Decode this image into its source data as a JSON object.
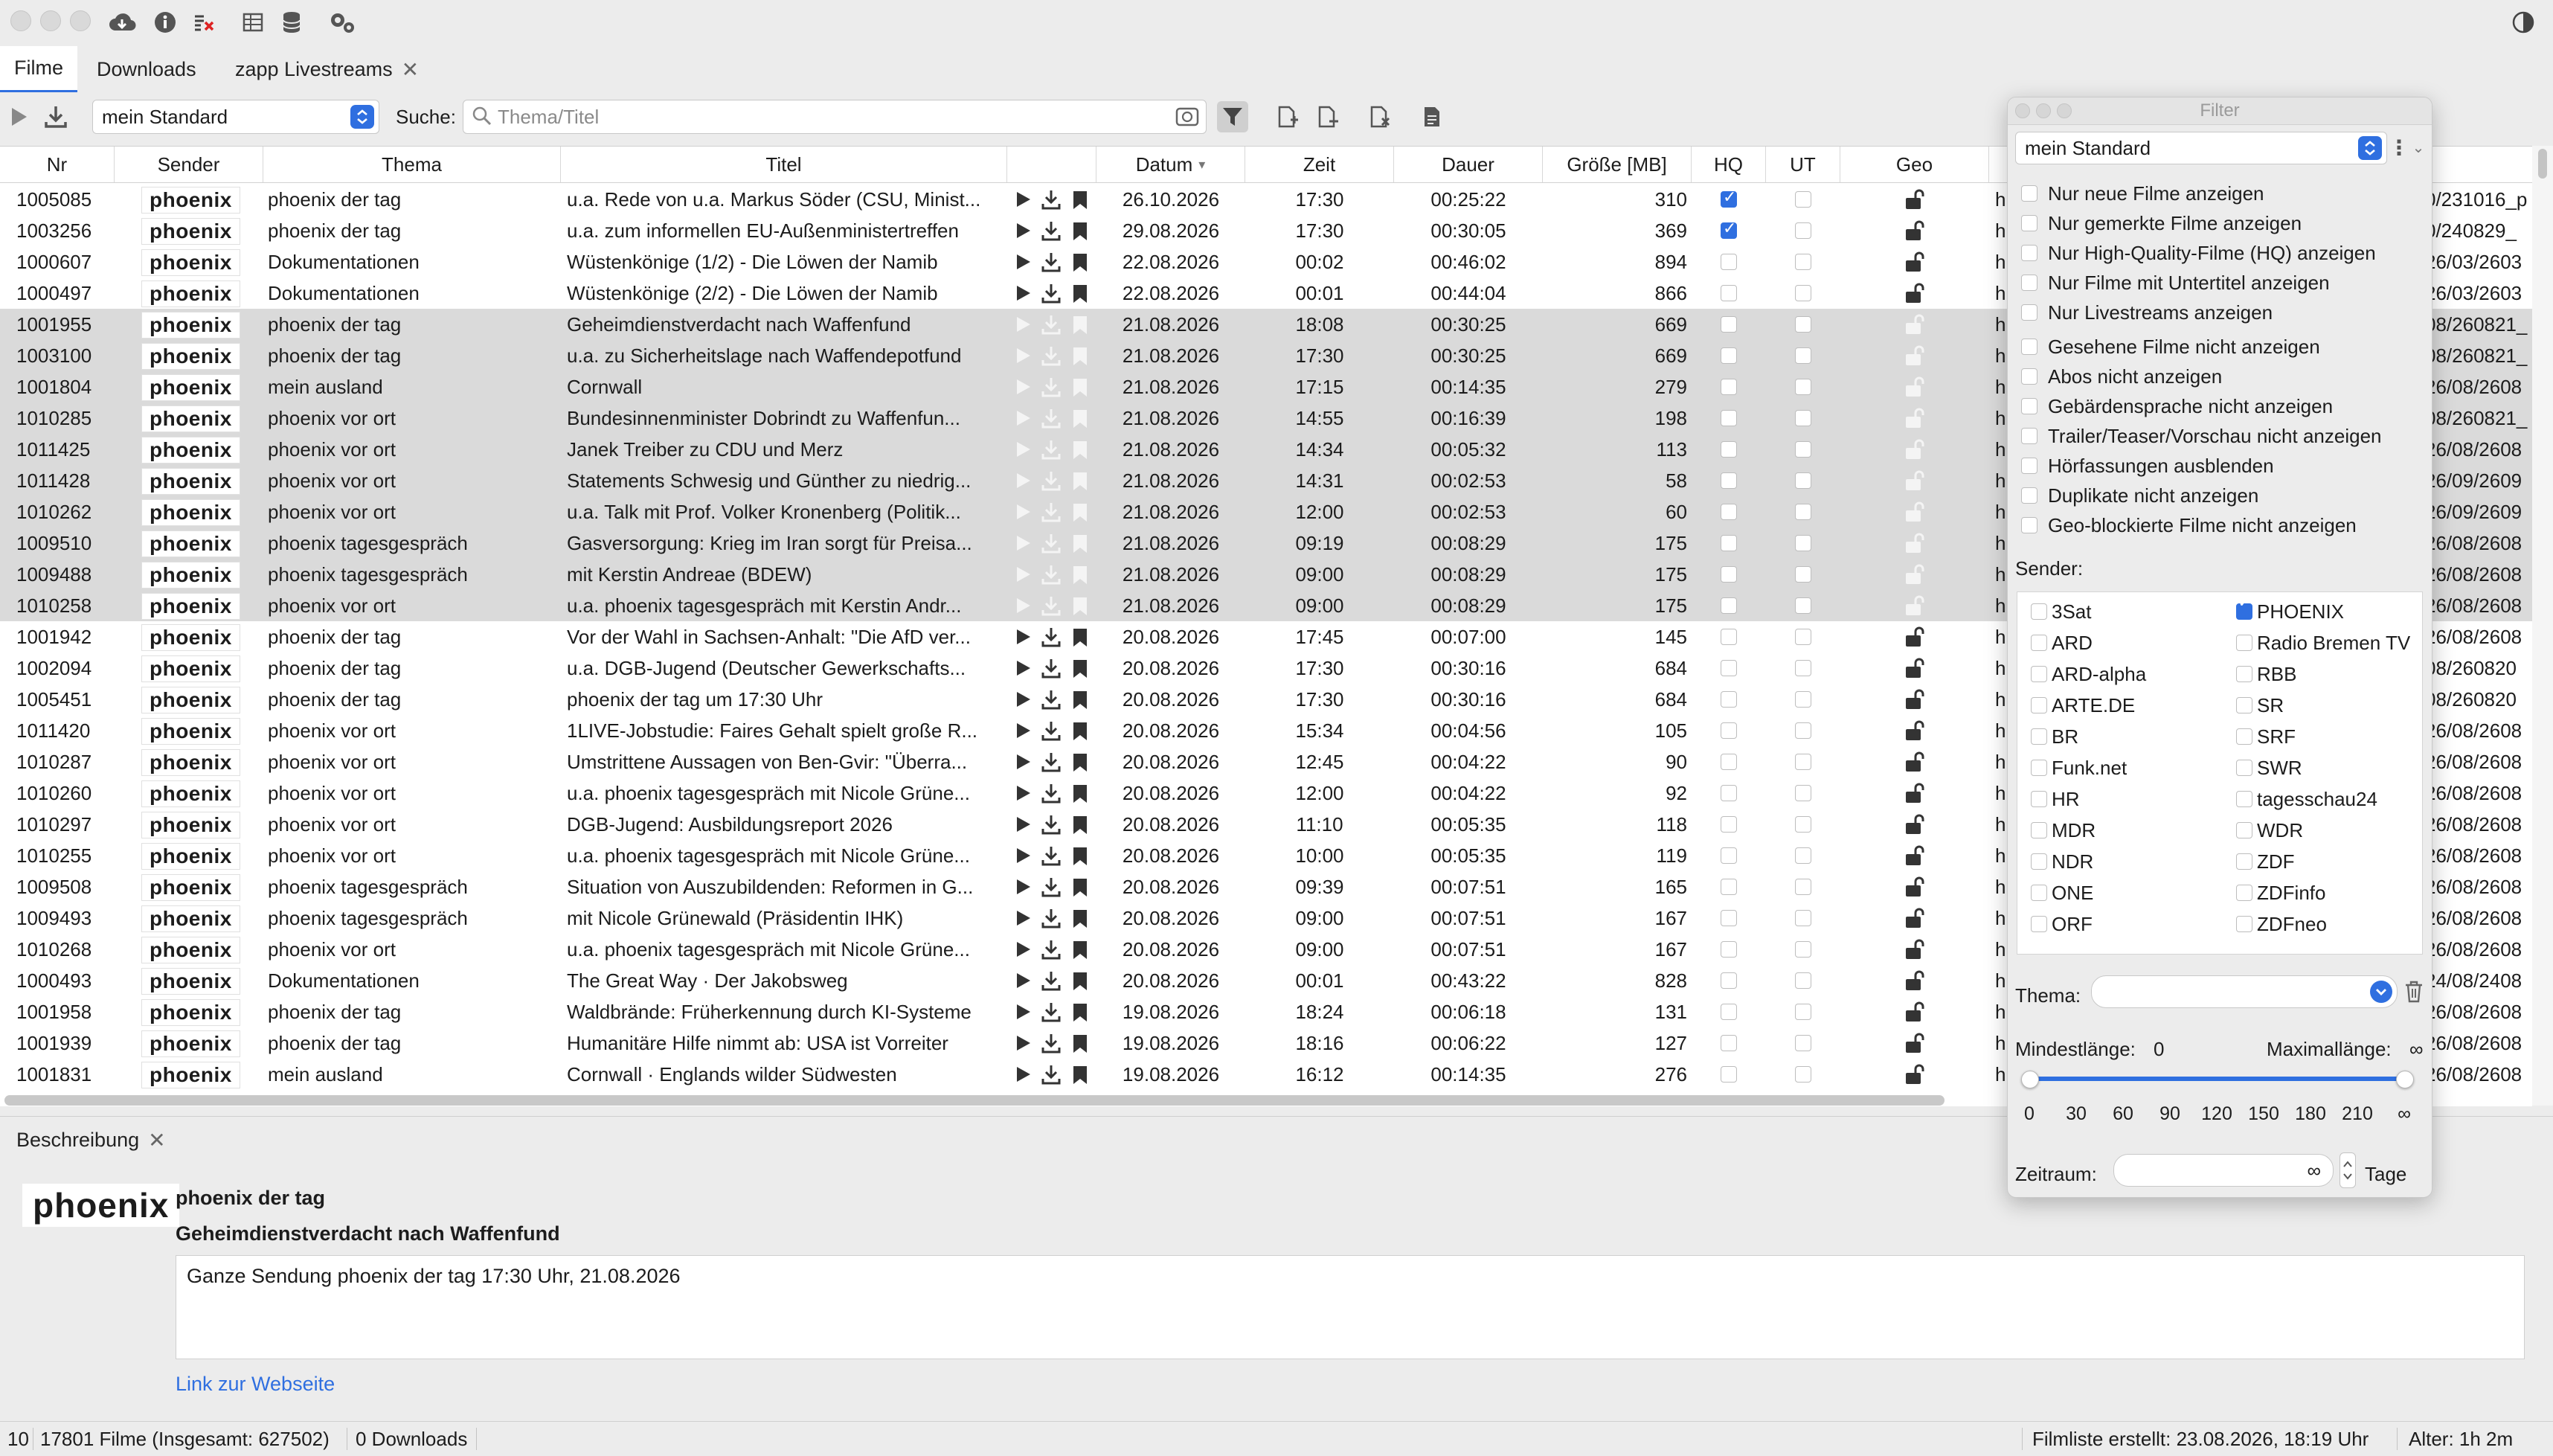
{
  "tabs": [
    {
      "label": "Filme",
      "active": true
    },
    {
      "label": "Downloads",
      "active": false
    },
    {
      "label": "zapp Livestreams",
      "active": false,
      "closable": true
    }
  ],
  "search": {
    "profile": "mein Standard",
    "label": "Suche:",
    "placeholder": "Thema/Titel"
  },
  "columns": [
    "Nr",
    "Sender",
    "Thema",
    "Titel",
    "Datum",
    "Zeit",
    "Dauer",
    "Größe [MB]",
    "HQ",
    "UT",
    "Geo"
  ],
  "rows": [
    {
      "nr": "1005085",
      "sender": "phoenix",
      "thema": "phoenix der tag",
      "titel": "u.a. Rede von u.a. Markus Söder (CSU, Minist...",
      "datum": "26.10.2026",
      "zeit": "17:30",
      "dauer": "00:25:22",
      "groesse": "310",
      "hq": true,
      "ut": false,
      "sel": false,
      "url": "0/231016_p"
    },
    {
      "nr": "1003256",
      "sender": "phoenix",
      "thema": "phoenix der tag",
      "titel": "u.a. zum informellen EU-Außenministertreffen",
      "datum": "29.08.2026",
      "zeit": "17:30",
      "dauer": "00:30:05",
      "groesse": "369",
      "hq": true,
      "ut": false,
      "sel": false,
      "url": "0/240829_"
    },
    {
      "nr": "1000607",
      "sender": "phoenix",
      "thema": "Dokumentationen",
      "titel": "Wüstenkönige (1/2) - Die Löwen der Namib",
      "datum": "22.08.2026",
      "zeit": "00:02",
      "dauer": "00:46:02",
      "groesse": "894",
      "hq": false,
      "ut": false,
      "sel": false,
      "url": "26/03/2603"
    },
    {
      "nr": "1000497",
      "sender": "phoenix",
      "thema": "Dokumentationen",
      "titel": "Wüstenkönige (2/2) - Die Löwen der Namib",
      "datum": "22.08.2026",
      "zeit": "00:01",
      "dauer": "00:44:04",
      "groesse": "866",
      "hq": false,
      "ut": false,
      "sel": false,
      "url": "26/03/2603"
    },
    {
      "nr": "1001955",
      "sender": "phoenix",
      "thema": "phoenix der tag",
      "titel": "Geheimdienstverdacht nach Waffenfund",
      "datum": "21.08.2026",
      "zeit": "18:08",
      "dauer": "00:30:25",
      "groesse": "669",
      "hq": false,
      "ut": false,
      "sel": true,
      "url": "08/260821_"
    },
    {
      "nr": "1003100",
      "sender": "phoenix",
      "thema": "phoenix der tag",
      "titel": "u.a. zu Sicherheitslage nach Waffendepotfund",
      "datum": "21.08.2026",
      "zeit": "17:30",
      "dauer": "00:30:25",
      "groesse": "669",
      "hq": false,
      "ut": false,
      "sel": true,
      "url": "08/260821_"
    },
    {
      "nr": "1001804",
      "sender": "phoenix",
      "thema": "mein ausland",
      "titel": "Cornwall",
      "datum": "21.08.2026",
      "zeit": "17:15",
      "dauer": "00:14:35",
      "groesse": "279",
      "hq": false,
      "ut": false,
      "sel": true,
      "url": "26/08/2608"
    },
    {
      "nr": "1010285",
      "sender": "phoenix",
      "thema": "phoenix vor ort",
      "titel": "Bundesinnenminister Dobrindt zu Waffenfun...",
      "datum": "21.08.2026",
      "zeit": "14:55",
      "dauer": "00:16:39",
      "groesse": "198",
      "hq": false,
      "ut": false,
      "sel": true,
      "url": "08/260821_"
    },
    {
      "nr": "1011425",
      "sender": "phoenix",
      "thema": "phoenix vor ort",
      "titel": "Janek Treiber zu CDU und Merz",
      "datum": "21.08.2026",
      "zeit": "14:34",
      "dauer": "00:05:32",
      "groesse": "113",
      "hq": false,
      "ut": false,
      "sel": true,
      "url": "26/08/2608"
    },
    {
      "nr": "1011428",
      "sender": "phoenix",
      "thema": "phoenix vor ort",
      "titel": "Statements Schwesig und Günther zu niedrig...",
      "datum": "21.08.2026",
      "zeit": "14:31",
      "dauer": "00:02:53",
      "groesse": "58",
      "hq": false,
      "ut": false,
      "sel": true,
      "url": "26/09/2609"
    },
    {
      "nr": "1010262",
      "sender": "phoenix",
      "thema": "phoenix vor ort",
      "titel": "u.a. Talk mit Prof. Volker Kronenberg (Politik...",
      "datum": "21.08.2026",
      "zeit": "12:00",
      "dauer": "00:02:53",
      "groesse": "60",
      "hq": false,
      "ut": false,
      "sel": true,
      "url": "26/09/2609"
    },
    {
      "nr": "1009510",
      "sender": "phoenix",
      "thema": "phoenix tagesgespräch",
      "titel": "Gasversorgung: Krieg im Iran sorgt für Preisa...",
      "datum": "21.08.2026",
      "zeit": "09:19",
      "dauer": "00:08:29",
      "groesse": "175",
      "hq": false,
      "ut": false,
      "sel": true,
      "url": "26/08/2608"
    },
    {
      "nr": "1009488",
      "sender": "phoenix",
      "thema": "phoenix tagesgespräch",
      "titel": "mit Kerstin Andreae (BDEW)",
      "datum": "21.08.2026",
      "zeit": "09:00",
      "dauer": "00:08:29",
      "groesse": "175",
      "hq": false,
      "ut": false,
      "sel": true,
      "url": "26/08/2608"
    },
    {
      "nr": "1010258",
      "sender": "phoenix",
      "thema": "phoenix vor ort",
      "titel": "u.a. phoenix tagesgespräch mit Kerstin Andr...",
      "datum": "21.08.2026",
      "zeit": "09:00",
      "dauer": "00:08:29",
      "groesse": "175",
      "hq": false,
      "ut": false,
      "sel": true,
      "url": "26/08/2608"
    },
    {
      "nr": "1001942",
      "sender": "phoenix",
      "thema": "phoenix der tag",
      "titel": "Vor der Wahl in Sachsen-Anhalt: \"Die AfD ver...",
      "datum": "20.08.2026",
      "zeit": "17:45",
      "dauer": "00:07:00",
      "groesse": "145",
      "hq": false,
      "ut": false,
      "sel": false,
      "url": "26/08/2608"
    },
    {
      "nr": "1002094",
      "sender": "phoenix",
      "thema": "phoenix der tag",
      "titel": "u.a. DGB-Jugend (Deutscher Gewerkschafts...",
      "datum": "20.08.2026",
      "zeit": "17:30",
      "dauer": "00:30:16",
      "groesse": "684",
      "hq": false,
      "ut": false,
      "sel": false,
      "url": "08/260820"
    },
    {
      "nr": "1005451",
      "sender": "phoenix",
      "thema": "phoenix der tag",
      "titel": "phoenix der tag um 17:30 Uhr",
      "datum": "20.08.2026",
      "zeit": "17:30",
      "dauer": "00:30:16",
      "groesse": "684",
      "hq": false,
      "ut": false,
      "sel": false,
      "url": "08/260820"
    },
    {
      "nr": "1011420",
      "sender": "phoenix",
      "thema": "phoenix vor ort",
      "titel": "1LIVE-Jobstudie: Faires Gehalt spielt große R...",
      "datum": "20.08.2026",
      "zeit": "15:34",
      "dauer": "00:04:56",
      "groesse": "105",
      "hq": false,
      "ut": false,
      "sel": false,
      "url": "26/08/2608"
    },
    {
      "nr": "1010287",
      "sender": "phoenix",
      "thema": "phoenix vor ort",
      "titel": "Umstrittene Aussagen von Ben-Gvir: \"Überra...",
      "datum": "20.08.2026",
      "zeit": "12:45",
      "dauer": "00:04:22",
      "groesse": "90",
      "hq": false,
      "ut": false,
      "sel": false,
      "url": "26/08/2608"
    },
    {
      "nr": "1010260",
      "sender": "phoenix",
      "thema": "phoenix vor ort",
      "titel": "u.a. phoenix tagesgespräch mit Nicole Grüne...",
      "datum": "20.08.2026",
      "zeit": "12:00",
      "dauer": "00:04:22",
      "groesse": "92",
      "hq": false,
      "ut": false,
      "sel": false,
      "url": "26/08/2608"
    },
    {
      "nr": "1010297",
      "sender": "phoenix",
      "thema": "phoenix vor ort",
      "titel": "DGB-Jugend: Ausbildungsreport 2026",
      "datum": "20.08.2026",
      "zeit": "11:10",
      "dauer": "00:05:35",
      "groesse": "118",
      "hq": false,
      "ut": false,
      "sel": false,
      "url": "26/08/2608"
    },
    {
      "nr": "1010255",
      "sender": "phoenix",
      "thema": "phoenix vor ort",
      "titel": "u.a. phoenix tagesgespräch mit Nicole Grüne...",
      "datum": "20.08.2026",
      "zeit": "10:00",
      "dauer": "00:05:35",
      "groesse": "119",
      "hq": false,
      "ut": false,
      "sel": false,
      "url": "26/08/2608"
    },
    {
      "nr": "1009508",
      "sender": "phoenix",
      "thema": "phoenix tagesgespräch",
      "titel": "Situation von Auszubildenden: Reformen in G...",
      "datum": "20.08.2026",
      "zeit": "09:39",
      "dauer": "00:07:51",
      "groesse": "165",
      "hq": false,
      "ut": false,
      "sel": false,
      "url": "26/08/2608"
    },
    {
      "nr": "1009493",
      "sender": "phoenix",
      "thema": "phoenix tagesgespräch",
      "titel": "mit Nicole Grünewald (Präsidentin IHK)",
      "datum": "20.08.2026",
      "zeit": "09:00",
      "dauer": "00:07:51",
      "groesse": "167",
      "hq": false,
      "ut": false,
      "sel": false,
      "url": "26/08/2608"
    },
    {
      "nr": "1010268",
      "sender": "phoenix",
      "thema": "phoenix vor ort",
      "titel": "u.a. phoenix tagesgespräch mit Nicole Grüne...",
      "datum": "20.08.2026",
      "zeit": "09:00",
      "dauer": "00:07:51",
      "groesse": "167",
      "hq": false,
      "ut": false,
      "sel": false,
      "url": "26/08/2608"
    },
    {
      "nr": "1000493",
      "sender": "phoenix",
      "thema": "Dokumentationen",
      "titel": "The Great Way · Der Jakobsweg",
      "datum": "20.08.2026",
      "zeit": "00:01",
      "dauer": "00:43:22",
      "groesse": "828",
      "hq": false,
      "ut": false,
      "sel": false,
      "url": "24/08/2408"
    },
    {
      "nr": "1001958",
      "sender": "phoenix",
      "thema": "phoenix der tag",
      "titel": "Waldbrände: Früherkennung durch KI-Systeme",
      "datum": "19.08.2026",
      "zeit": "18:24",
      "dauer": "00:06:18",
      "groesse": "131",
      "hq": false,
      "ut": false,
      "sel": false,
      "url": "26/08/2608"
    },
    {
      "nr": "1001939",
      "sender": "phoenix",
      "thema": "phoenix der tag",
      "titel": "Humanitäre Hilfe nimmt ab: USA ist Vorreiter",
      "datum": "19.08.2026",
      "zeit": "18:16",
      "dauer": "00:06:22",
      "groesse": "127",
      "hq": false,
      "ut": false,
      "sel": false,
      "url": "26/08/2608"
    },
    {
      "nr": "1001831",
      "sender": "phoenix",
      "thema": "mein ausland",
      "titel": "Cornwall · Englands wilder Südwesten",
      "datum": "19.08.2026",
      "zeit": "16:12",
      "dauer": "00:14:35",
      "groesse": "276",
      "hq": false,
      "ut": false,
      "sel": false,
      "url": "26/08/2608"
    }
  ],
  "url_prefix": "h",
  "description": {
    "tab": "Beschreibung",
    "logo": "phoenix",
    "thema": "phoenix der tag",
    "titel": "Geheimdienstverdacht nach Waffenfund",
    "text": "Ganze Sendung phoenix der tag 17:30 Uhr, 21.08.2026",
    "link": "Link zur Webseite"
  },
  "status": {
    "left": "10",
    "films": "17801 Filme (Insgesamt: 627502)",
    "downloads": "0 Downloads",
    "created": "Filmliste erstellt: 23.08.2026, 18:19 Uhr",
    "age": "Alter: 1h 2m"
  },
  "filter": {
    "title": "Filter",
    "profile": "mein Standard",
    "options": [
      "Nur neue Filme anzeigen",
      "Nur gemerkte Filme anzeigen",
      "Nur High-Quality-Filme (HQ) anzeigen",
      "Nur Filme mit Untertitel anzeigen",
      "Nur Livestreams anzeigen",
      "Gesehene Filme nicht anzeigen",
      "Abos nicht anzeigen",
      "Gebärdensprache nicht anzeigen",
      "Trailer/Teaser/Vorschau nicht anzeigen",
      "Hörfassungen ausblenden",
      "Duplikate nicht anzeigen",
      "Geo-blockierte Filme nicht anzeigen"
    ],
    "sender_label": "Sender:",
    "senders_left": [
      "3Sat",
      "ARD",
      "ARD-alpha",
      "ARTE.DE",
      "BR",
      "Funk.net",
      "HR",
      "MDR",
      "NDR",
      "ONE",
      "ORF"
    ],
    "senders_right": [
      "PHOENIX",
      "Radio Bremen TV",
      "RBB",
      "SR",
      "SRF",
      "SWR",
      "tagesschau24",
      "WDR",
      "ZDF",
      "ZDFinfo",
      "ZDFneo"
    ],
    "checked_sender": "PHOENIX",
    "thema_label": "Thema:",
    "min_label": "Mindestlänge:",
    "min_value": "0",
    "max_label": "Maximallänge:",
    "max_value": "∞",
    "ticks": [
      "0",
      "30",
      "60",
      "90",
      "120",
      "150",
      "180",
      "210",
      "∞"
    ],
    "zeitraum_label": "Zeitraum:",
    "zeitraum_value": "∞",
    "tage_label": "Tage"
  },
  "colors": {
    "accent": "#2f6fe0",
    "selection": "#dadada"
  }
}
